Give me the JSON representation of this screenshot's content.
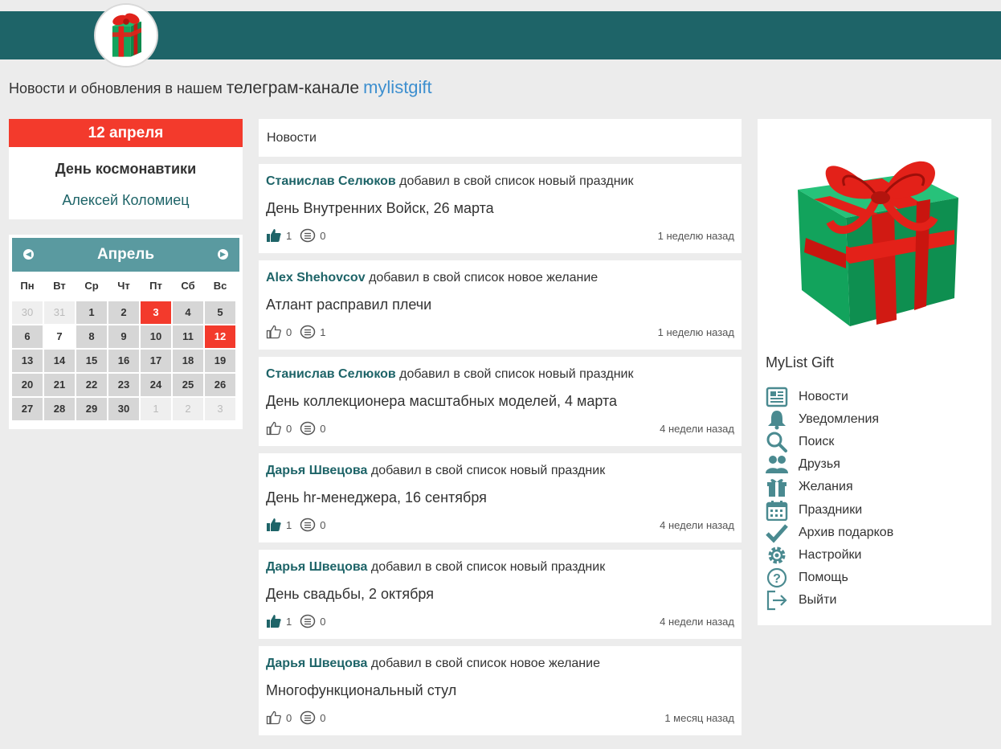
{
  "announcement": {
    "prefix": "Новости и обновления в нашем",
    "channel": "телеграм-канале",
    "link": "mylistgift"
  },
  "holiday": {
    "date": "12 апреля",
    "name": "День космонавтики",
    "author": "Алексей Коломиец"
  },
  "calendar": {
    "month": "Апрель",
    "weekdays": [
      "Пн",
      "Вт",
      "Ср",
      "Чт",
      "Пт",
      "Сб",
      "Вс"
    ],
    "days": [
      {
        "d": "30",
        "t": "other"
      },
      {
        "d": "31",
        "t": "other"
      },
      {
        "d": "1",
        "t": ""
      },
      {
        "d": "2",
        "t": ""
      },
      {
        "d": "3",
        "t": "red"
      },
      {
        "d": "4",
        "t": ""
      },
      {
        "d": "5",
        "t": ""
      },
      {
        "d": "6",
        "t": ""
      },
      {
        "d": "7",
        "t": "white"
      },
      {
        "d": "8",
        "t": ""
      },
      {
        "d": "9",
        "t": ""
      },
      {
        "d": "10",
        "t": ""
      },
      {
        "d": "11",
        "t": ""
      },
      {
        "d": "12",
        "t": "red"
      },
      {
        "d": "13",
        "t": ""
      },
      {
        "d": "14",
        "t": ""
      },
      {
        "d": "15",
        "t": ""
      },
      {
        "d": "16",
        "t": ""
      },
      {
        "d": "17",
        "t": ""
      },
      {
        "d": "18",
        "t": ""
      },
      {
        "d": "19",
        "t": ""
      },
      {
        "d": "20",
        "t": ""
      },
      {
        "d": "21",
        "t": ""
      },
      {
        "d": "22",
        "t": ""
      },
      {
        "d": "23",
        "t": ""
      },
      {
        "d": "24",
        "t": ""
      },
      {
        "d": "25",
        "t": ""
      },
      {
        "d": "26",
        "t": ""
      },
      {
        "d": "27",
        "t": ""
      },
      {
        "d": "28",
        "t": ""
      },
      {
        "d": "29",
        "t": ""
      },
      {
        "d": "30",
        "t": ""
      },
      {
        "d": "1",
        "t": "other"
      },
      {
        "d": "2",
        "t": "other"
      },
      {
        "d": "3",
        "t": "other"
      }
    ]
  },
  "feed": {
    "title": "Новости",
    "posts": [
      {
        "author": "Станислав Селюков",
        "action": "добавил в свой список новый праздник",
        "title": "День Внутренних Войск, 26 марта",
        "likes": "1",
        "liked": true,
        "comments": "0",
        "time": "1 неделю назад"
      },
      {
        "author": "Alex Shehovcov",
        "action": "добавил в свой список новое желание",
        "title": "Атлант расправил плечи",
        "likes": "0",
        "liked": false,
        "comments": "1",
        "time": "1 неделю назад"
      },
      {
        "author": "Станислав Селюков",
        "action": "добавил в свой список новый праздник",
        "title": "День коллекционера масштабных моделей, 4 марта",
        "likes": "0",
        "liked": false,
        "comments": "0",
        "time": "4 недели назад"
      },
      {
        "author": "Дарья Швецова",
        "action": "добавил в свой список новый праздник",
        "title": "День hr-менеджера, 16 сентября",
        "likes": "1",
        "liked": true,
        "comments": "0",
        "time": "4 недели назад"
      },
      {
        "author": "Дарья Швецова",
        "action": "добавил в свой список новый праздник",
        "title": "День свадьбы, 2 октября",
        "likes": "1",
        "liked": true,
        "comments": "0",
        "time": "4 недели назад"
      },
      {
        "author": "Дарья Швецова",
        "action": "добавил в свой список новое желание",
        "title": "Многофункциональный стул",
        "likes": "0",
        "liked": false,
        "comments": "0",
        "time": "1 месяц назад"
      }
    ]
  },
  "sidebar": {
    "title": "MyList Gift",
    "menu": [
      {
        "label": "Новости",
        "icon": "newspaper-icon"
      },
      {
        "label": "Уведомления",
        "icon": "bell-icon"
      },
      {
        "label": "Поиск",
        "icon": "search-icon"
      },
      {
        "label": "Друзья",
        "icon": "friends-icon"
      },
      {
        "label": "Желания",
        "icon": "gift-icon"
      },
      {
        "label": "Праздники",
        "icon": "calendar-icon"
      },
      {
        "label": "Архив подарков",
        "icon": "checkmark-icon"
      },
      {
        "label": "Настройки",
        "icon": "gear-icon"
      },
      {
        "label": "Помощь",
        "icon": "help-icon"
      },
      {
        "label": "Выйти",
        "icon": "logout-icon"
      }
    ]
  },
  "colors": {
    "header": "#1e6468",
    "accent_red": "#f33a2c",
    "calendar_head": "#5a9aa0",
    "link": "#3d8fcf",
    "icon": "#4a8a90"
  }
}
